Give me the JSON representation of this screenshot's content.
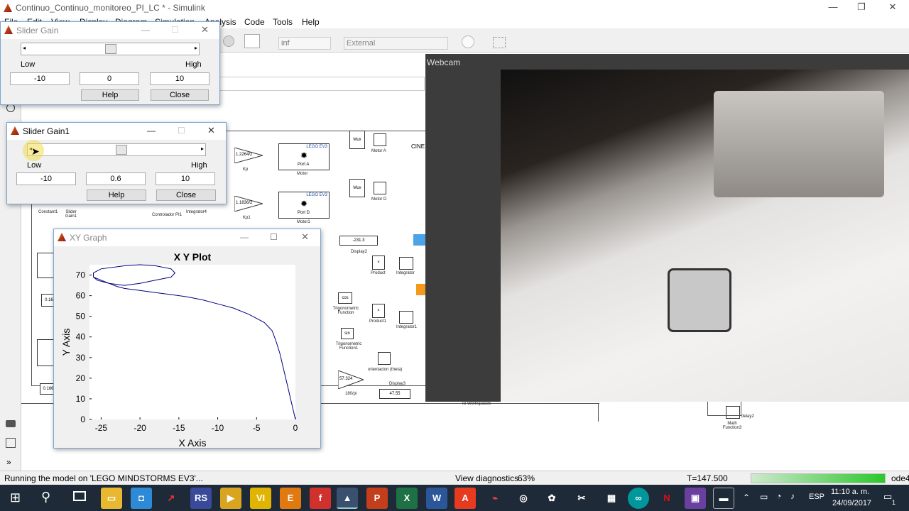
{
  "app": {
    "title": "Continuo_Continuo_monitoreo_PI_LC * - Simulink",
    "menu": [
      "File",
      "Edit",
      "View",
      "Display",
      "Diagram",
      "Simulation",
      "Analysis",
      "Code",
      "Tools",
      "Help"
    ],
    "toolbar": {
      "stop_time": "inf",
      "mode": "External"
    }
  },
  "slider_gain": {
    "title": "Slider Gain",
    "low_label": "Low",
    "high_label": "High",
    "low": "-10",
    "value": "0",
    "high": "10",
    "level": 0.5,
    "help": "Help",
    "close": "Close"
  },
  "slider_gain1": {
    "title": "Slider Gain1",
    "low_label": "Low",
    "high_label": "High",
    "low": "-10",
    "value": "0.6",
    "high": "10",
    "level": 0.53,
    "help": "Help",
    "close": "Close"
  },
  "xy_graph": {
    "title": "XY Graph",
    "chart_data": {
      "type": "line",
      "title": "X Y Plot",
      "xlabel": "X Axis",
      "ylabel": "Y Axis",
      "xlim": [
        -26.5,
        0
      ],
      "ylim": [
        0,
        75
      ],
      "xticks": [
        -25,
        -20,
        -15,
        -10,
        -5,
        0
      ],
      "yticks": [
        0,
        10,
        20,
        30,
        40,
        50,
        60,
        70
      ],
      "series": [
        {
          "x": [
            0,
            -0.5,
            -1,
            -1.5,
            -2,
            -2.5,
            -3,
            -4,
            -6,
            -8,
            -10,
            -12,
            -14,
            -16,
            -18,
            -20,
            -21,
            -22,
            -23,
            -24,
            -25,
            -26,
            -26,
            -25,
            -22,
            -20,
            -18,
            -16,
            -15.5,
            -16,
            -18,
            -20,
            -22,
            -24,
            -25.5,
            -26
          ],
          "y": [
            0,
            8,
            16,
            24,
            32,
            38,
            43,
            47,
            51,
            54,
            56,
            58,
            59.5,
            60.5,
            61.5,
            62.5,
            63,
            63.5,
            64.5,
            66,
            67.5,
            69,
            71,
            73,
            74.5,
            75,
            74.5,
            73,
            71,
            69,
            67.5,
            66,
            65,
            66,
            67.5,
            69
          ],
          "color": "#000080"
        }
      ]
    }
  },
  "webcam": {
    "title": "Webcam"
  },
  "diagram": {
    "blocks": [
      "Kp",
      "Kp1",
      "Motor",
      "Motor1",
      "Motor A",
      "Motor D",
      "Mux",
      "Mux",
      "Display2",
      "Display3",
      "Product",
      "Product1",
      "Integrator",
      "Integrator1",
      "Trigonometric Function",
      "Trigonometric Function1",
      "To Workspace5",
      "orientacion (theta)",
      "Math Function3",
      "delay2",
      "Constant1",
      "Slider Gain1",
      "Controlador PI1",
      "Integrator4",
      "180/pi",
      "CINE"
    ],
    "values": {
      "kp": "1.2264/2",
      "kp1": "1.1836/2",
      "display2": "-231.3",
      "display3": "47.55",
      "gain180": "57.324",
      "constant": "0.16",
      "constant2": "0.166"
    },
    "lego_labels": [
      "LEGO EV3",
      "LEGO EV3"
    ],
    "ports": [
      "Port A",
      "Port D"
    ],
    "trig": [
      "cos",
      "sin"
    ]
  },
  "status": {
    "left": "Running the model on 'LEGO MINDSTORMS EV3'...",
    "diagnostics": "View diagnostics",
    "zoom": "63%",
    "time": "T=147.500",
    "solver": "ode4",
    "progress": 1.0
  },
  "taskbar": {
    "time": "11:10 a. m.",
    "date": "24/09/2017",
    "lang": "ESP",
    "notif": "1"
  }
}
